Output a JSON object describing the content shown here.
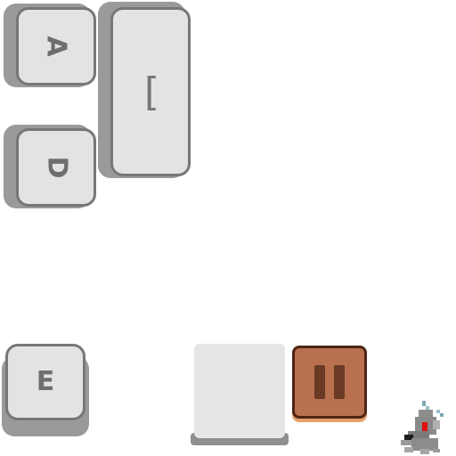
{
  "keys": {
    "a": {
      "label": "A"
    },
    "d": {
      "label": "D"
    },
    "bracket": {
      "label": "["
    },
    "e": {
      "label": "E"
    }
  },
  "pause": {
    "state": "paused"
  },
  "colors": {
    "key_face": "#e3e3e3",
    "key_border": "#777777",
    "key_shadow": "#9a9a9a",
    "pause_fill": "#b8704f",
    "pause_border": "#4e2516",
    "pause_bars": "#6a3a25"
  },
  "icons": {
    "pause": "pause-icon",
    "robot": "robot-icon"
  }
}
